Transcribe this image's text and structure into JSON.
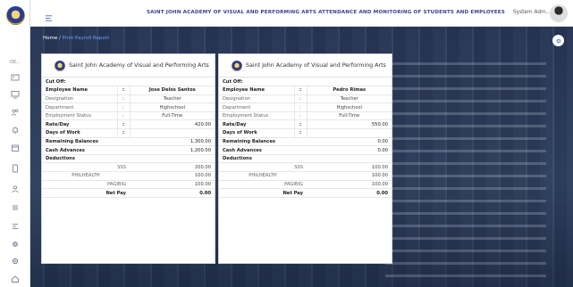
{
  "topbar": {
    "title": "SAINT JOHN ACADEMY OF VISUAL AND PERFORMING ARTS ATTENDANCE AND MONITORING OF STUDENTS AND EMPLOYEES",
    "user_name": "System Adm..."
  },
  "breadcrumb": {
    "home": "Home",
    "separator": "/",
    "current": "Print Payroll Report"
  },
  "sidebar": {
    "items": [
      {
        "icon": "dashboard-icon",
        "label": "DE..."
      },
      {
        "icon": "image-icon"
      },
      {
        "icon": "monitor-icon"
      },
      {
        "icon": "users-icon"
      },
      {
        "icon": "bell-icon"
      },
      {
        "icon": "calendar-icon"
      },
      {
        "icon": "file-icon"
      },
      {
        "icon": "user-group-icon"
      },
      {
        "icon": "list-icon"
      },
      {
        "icon": "menu-lines-icon"
      },
      {
        "icon": "settings-icon"
      },
      {
        "icon": "gear-icon"
      },
      {
        "icon": "home-icon"
      }
    ]
  },
  "cards": [
    {
      "school": "Saint John Academy of Visual and Performing Arts",
      "cut_off_label": "Cut Off:",
      "employee_name_label": "Employee Name",
      "employee_name": "Jose Delos Santos",
      "designation_label": "Designation",
      "designation": "Teacher",
      "department_label": "Department",
      "department": "Highschool",
      "status_label": "Employment Status",
      "status": "Full-Time",
      "rate_label": "Rate/Day",
      "rate": "420.00",
      "days_label": "Days of Work",
      "days": "",
      "balances_label": "Remaining Balances",
      "balances": "1,300.00",
      "advances_label": "Cash Advances",
      "advances": "1,200.00",
      "deductions_label": "Deductions",
      "sss_label": "SSS",
      "sss": "200.00",
      "philhealth_label": "PHILHEALTH",
      "philhealth": "100.00",
      "pagibig_label": "PAGIBIG",
      "pagibig": "100.00",
      "net_pay_label": "Net Pay",
      "net_pay": "0.00"
    },
    {
      "school": "Saint John Academy of Visual and Performing Arts",
      "cut_off_label": "Cut Off:",
      "employee_name_label": "Employee Name",
      "employee_name": "Pedro Rimas",
      "designation_label": "Designation",
      "designation": "Teacher",
      "department_label": "Department",
      "department": "Highschool",
      "status_label": "Employment Status",
      "status": "Full-Time",
      "rate_label": "Rate/Day",
      "rate": "550.00",
      "days_label": "Days of Work",
      "days": "",
      "balances_label": "Remaining Balances",
      "balances": "0.00",
      "advances_label": "Cash Advances",
      "advances": "0.00",
      "deductions_label": "Deductions",
      "sss_label": "SSS",
      "sss": "100.00",
      "philhealth_label": "PHILHEALTH",
      "philhealth": "100.00",
      "pagibig_label": "PAGIBIG",
      "pagibig": "100.00",
      "net_pay_label": "Net Pay",
      "net_pay": "0.00"
    }
  ],
  "colon": ":",
  "colors": {
    "title": "#3c3f8f",
    "link": "#6aa0ff",
    "accent": "#5b7bd5"
  }
}
